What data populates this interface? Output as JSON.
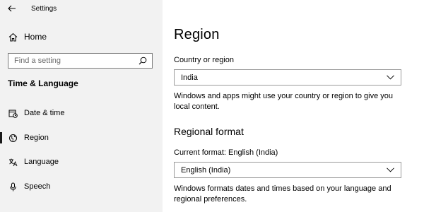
{
  "window": {
    "title": "Settings",
    "back_icon": "back-arrow-icon"
  },
  "sidebar": {
    "home": {
      "label": "Home",
      "icon": "home-icon"
    },
    "search": {
      "placeholder": "Find a setting",
      "icon": "search-icon"
    },
    "section_heading": "Time & Language",
    "items": [
      {
        "label": "Date & time",
        "icon": "date-time-icon",
        "selected": false
      },
      {
        "label": "Region",
        "icon": "globe-icon",
        "selected": true
      },
      {
        "label": "Language",
        "icon": "language-icon",
        "selected": false
      },
      {
        "label": "Speech",
        "icon": "microphone-icon",
        "selected": false
      }
    ]
  },
  "main": {
    "title": "Region",
    "country": {
      "label": "Country or region",
      "value": "India",
      "description": "Windows and apps might use your country or region to give you local content."
    },
    "regional_format": {
      "heading": "Regional format",
      "label": "Current format: English (India)",
      "value": "English (India)",
      "description": "Windows formats dates and times based on your language and regional preferences."
    }
  },
  "colors": {
    "sidebar_bg": "#f2f2f2",
    "content_bg": "#ffffff",
    "selection_bar": "#1a1a1a",
    "input_border": "#7a7a7a"
  }
}
